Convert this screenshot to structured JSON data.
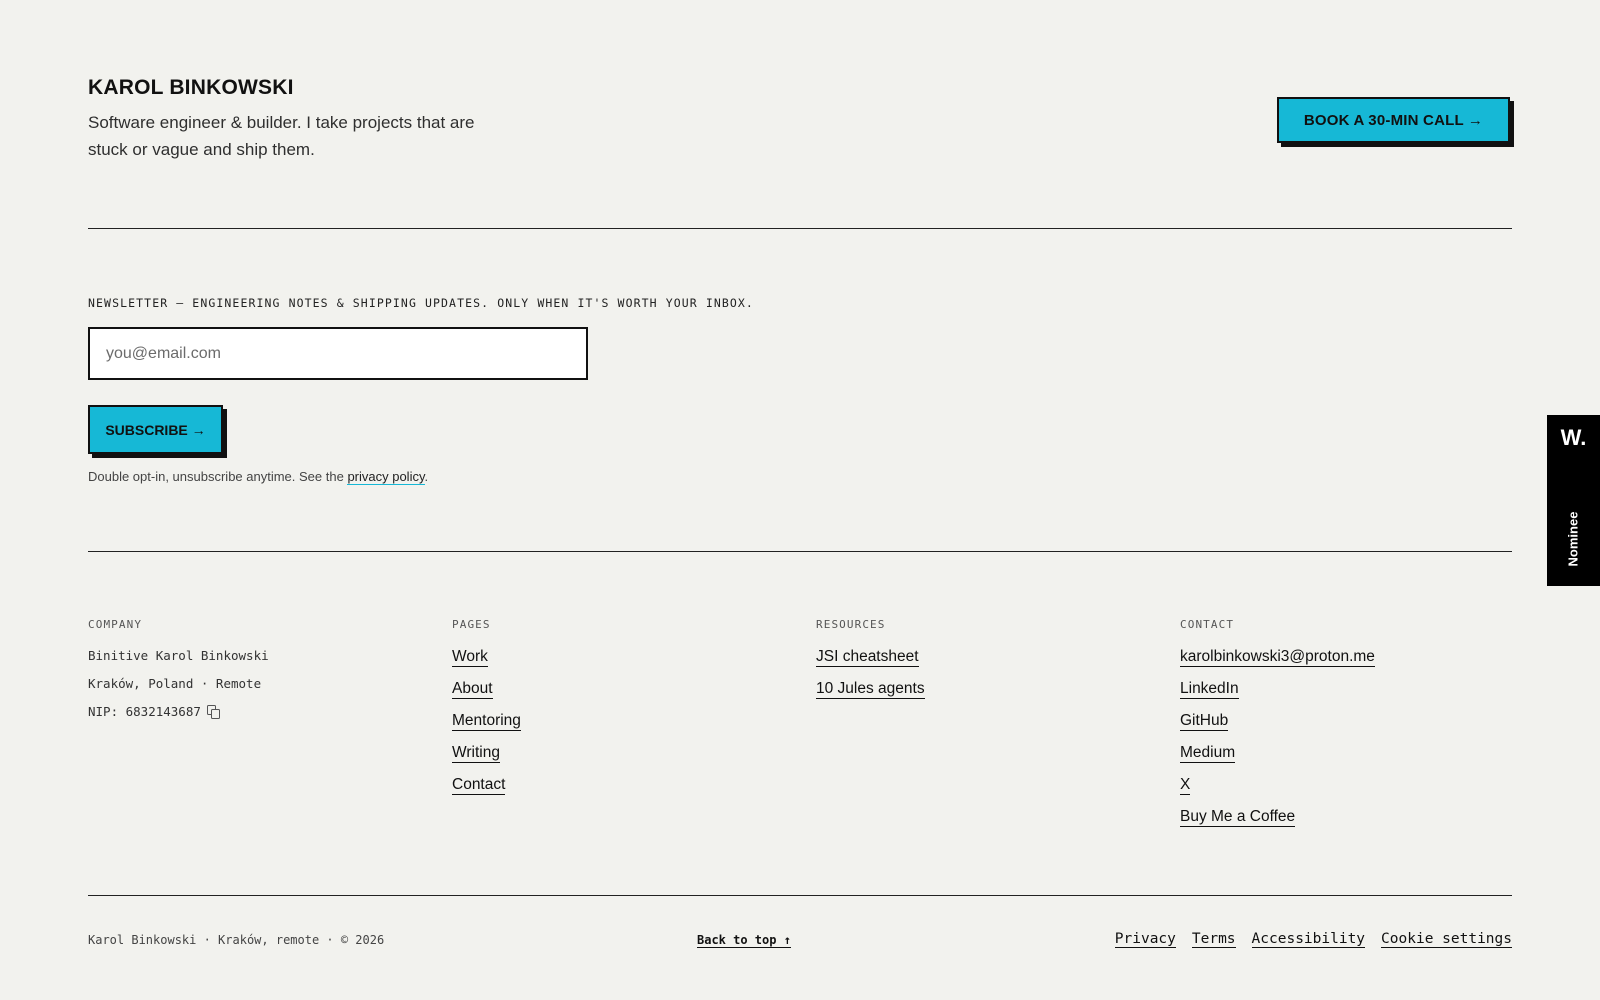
{
  "header": {
    "name": "KAROL BINKOWSKI",
    "tagline": "Software engineer & builder. I take projects that are stuck or vague and ship them.",
    "cta_label": "BOOK A 30-MIN CALL →"
  },
  "newsletter": {
    "label": "NEWSLETTER — ENGINEERING NOTES & SHIPPING UPDATES. ONLY WHEN IT'S WORTH YOUR INBOX.",
    "email_placeholder": "you@email.com",
    "email_value": "",
    "subscribe_label": "SUBSCRIBE →",
    "note_prefix": "Double opt-in, unsubscribe anytime. See the ",
    "privacy_link": "privacy policy",
    "note_suffix": "."
  },
  "columns": {
    "company": {
      "heading": "COMPANY",
      "lines": [
        "Binitive Karol Binkowski",
        "Kraków, Poland · Remote",
        "NIP: 6832143687"
      ]
    },
    "pages": {
      "heading": "PAGES",
      "links": [
        "Work",
        "About",
        "Mentoring",
        "Writing",
        "Contact"
      ]
    },
    "resources": {
      "heading": "RESOURCES",
      "links": [
        "JSI cheatsheet",
        "10 Jules agents"
      ]
    },
    "contact": {
      "heading": "CONTACT",
      "links": [
        "karolbinkowski3@proton.me",
        "LinkedIn",
        "GitHub",
        "Medium",
        "X",
        "Buy Me a Coffee"
      ]
    }
  },
  "bottom": {
    "copyright": "Karol Binkowski · Kraków, remote · © 2026",
    "back_to_top": "Back to top ↑",
    "legal": [
      "Privacy",
      "Terms",
      "Accessibility",
      "Cookie settings"
    ]
  },
  "badge": {
    "logo": "W.",
    "label": "Nominee"
  },
  "colors": {
    "background": "#f2f2ee",
    "accent": "#16b8d6",
    "ink": "#111111"
  },
  "icons": {
    "copy": "copy-icon"
  }
}
